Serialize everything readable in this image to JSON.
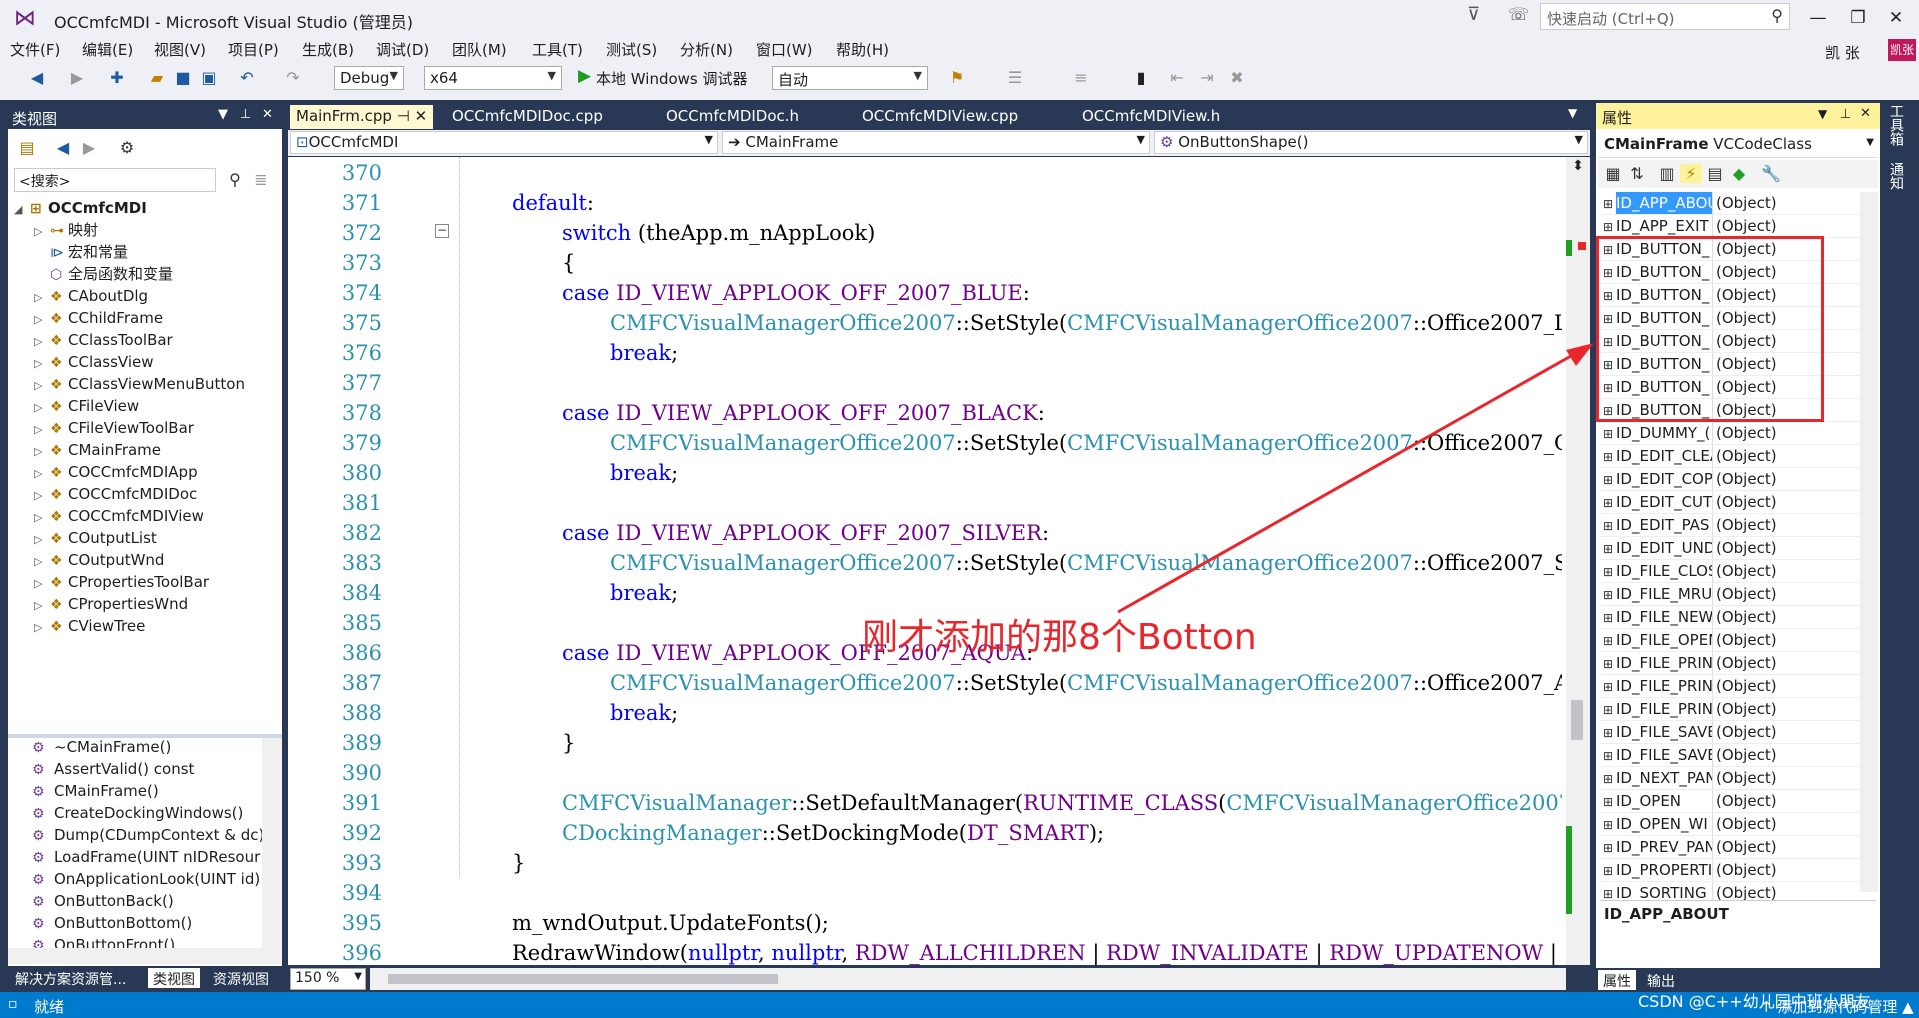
{
  "window": {
    "title": "OCCmfcMDI - Microsoft Visual Studio (管理员)",
    "quick_launch": "快速启动 (Ctrl+Q)",
    "user": "凯 张",
    "avatar": "凯张"
  },
  "menu": [
    "文件(F)",
    "编辑(E)",
    "视图(V)",
    "项目(P)",
    "生成(B)",
    "调试(D)",
    "团队(M)",
    "工具(T)",
    "测试(S)",
    "分析(N)",
    "窗口(W)",
    "帮助(H)"
  ],
  "toolbar": {
    "config": "Debug",
    "platform": "x64",
    "run_label": "本地 Windows 调试器",
    "mode": "自动"
  },
  "class_view": {
    "title": "类视图",
    "search": "<搜索>",
    "root": "OCCmfcMDI",
    "items": [
      "映射",
      "宏和常量",
      "全局函数和变量",
      "CAboutDlg",
      "CChildFrame",
      "CClassToolBar",
      "CClassView",
      "CClassViewMenuButton",
      "CFileView",
      "CFileViewToolBar",
      "CMainFrame",
      "COCCmfcMDIApp",
      "COCCmfcMDIDoc",
      "COCCmfcMDIView",
      "COutputList",
      "COutputWnd",
      "CPropertiesToolBar",
      "CPropertiesWnd",
      "CViewTree"
    ],
    "members": [
      "~CMainFrame()",
      "AssertValid() const",
      "CMainFrame()",
      "CreateDockingWindows()",
      "Dump(CDumpContext & dc)",
      "LoadFrame(UINT nIDResour",
      "OnApplicationLook(UINT id)",
      "OnButtonBack()",
      "OnButtonBottom()",
      "OnButtonFront()"
    ],
    "tabs": [
      "解决方案资源管...",
      "类视图",
      "资源视图"
    ]
  },
  "editor": {
    "tabs": [
      "MainFrm.cpp",
      "OCCmfcMDIDoc.cpp",
      "OCCmfcMDIDoc.h",
      "OCCmfcMDIView.cpp",
      "OCCmfcMDIView.h"
    ],
    "nav": [
      "OCCmfcMDI",
      "CMainFrame",
      "OnButtonShape()"
    ],
    "zoom": "150 %",
    "line_numbers": [
      "370",
      "371",
      "372",
      "373",
      "374",
      "375",
      "376",
      "377",
      "378",
      "379",
      "380",
      "381",
      "382",
      "383",
      "384",
      "385",
      "386",
      "387",
      "388",
      "389",
      "390",
      "391",
      "392",
      "393",
      "394",
      "395",
      "396"
    ]
  },
  "properties": {
    "title": "属性",
    "object": "CMainFrame",
    "object_type": "VCCodeClass",
    "rows": [
      [
        "ID_APP_ABOUT",
        "(Object)"
      ],
      [
        "ID_APP_EXIT",
        "(Object)"
      ],
      [
        "ID_BUTTON_",
        "(Object)"
      ],
      [
        "ID_BUTTON_",
        "(Object)"
      ],
      [
        "ID_BUTTON_",
        "(Object)"
      ],
      [
        "ID_BUTTON_",
        "(Object)"
      ],
      [
        "ID_BUTTON_",
        "(Object)"
      ],
      [
        "ID_BUTTON_",
        "(Object)"
      ],
      [
        "ID_BUTTON_",
        "(Object)"
      ],
      [
        "ID_BUTTON_",
        "(Object)"
      ],
      [
        "ID_DUMMY_(",
        "(Object)"
      ],
      [
        "ID_EDIT_CLEA",
        "(Object)"
      ],
      [
        "ID_EDIT_COP",
        "(Object)"
      ],
      [
        "ID_EDIT_CUT",
        "(Object)"
      ],
      [
        "ID_EDIT_PAS",
        "(Object)"
      ],
      [
        "ID_EDIT_UND",
        "(Object)"
      ],
      [
        "ID_FILE_CLOS",
        "(Object)"
      ],
      [
        "ID_FILE_MRU",
        "(Object)"
      ],
      [
        "ID_FILE_NEW",
        "(Object)"
      ],
      [
        "ID_FILE_OPEN",
        "(Object)"
      ],
      [
        "ID_FILE_PRIN",
        "(Object)"
      ],
      [
        "ID_FILE_PRIN",
        "(Object)"
      ],
      [
        "ID_FILE_PRIN",
        "(Object)"
      ],
      [
        "ID_FILE_SAVE",
        "(Object)"
      ],
      [
        "ID_FILE_SAVE",
        "(Object)"
      ],
      [
        "ID_NEXT_PAN",
        "(Object)"
      ],
      [
        "ID_OPEN",
        "(Object)"
      ],
      [
        "ID_OPEN_WI",
        "(Object)"
      ],
      [
        "ID_PREV_PAN",
        "(Object)"
      ],
      [
        "ID_PROPERTI",
        "(Object)"
      ],
      [
        "ID_SORTING_",
        "(Object)"
      ]
    ],
    "description": "ID_APP_ABOUT",
    "tabs": [
      "属性",
      "输出"
    ],
    "side": [
      "工具箱",
      "通知"
    ]
  },
  "annotation": "刚才添加的那8个Botton",
  "status": {
    "text": "就绪",
    "right": "↑ 添加到源代码管理 ▲",
    "watermark": "CSDN @C++幼儿园中班小朋友"
  },
  "colors": {
    "accent": "#007acc",
    "frame": "#293955",
    "annotation": "#e8262c"
  }
}
